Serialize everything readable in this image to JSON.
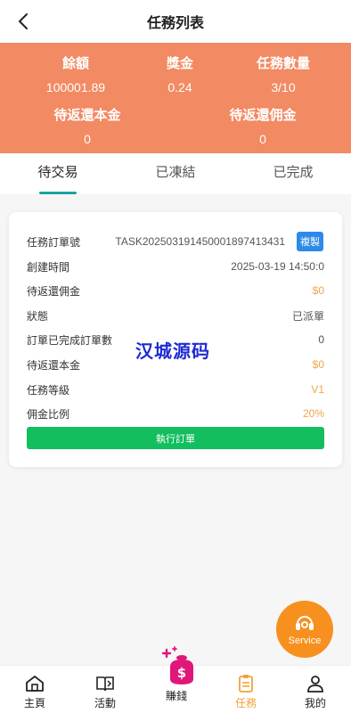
{
  "header": {
    "title": "任務列表"
  },
  "stats": {
    "balance_label": "餘額",
    "balance_value": "100001.89",
    "bonus_label": "獎金",
    "bonus_value": "0.24",
    "task_count_label": "任務數量",
    "task_count_value": "3/10",
    "pending_principal_label": "待返還本金",
    "pending_principal_value": "0",
    "pending_commission_label": "待返還佣金",
    "pending_commission_value": "0"
  },
  "tabs": [
    {
      "label": "待交易",
      "active": true
    },
    {
      "label": "已凍結",
      "active": false
    },
    {
      "label": "已完成",
      "active": false
    }
  ],
  "task": {
    "order_no_label": "任務訂單號",
    "order_no_value": "TASK2025031914500018974134​31",
    "copy_label": "複製",
    "created_label": "創建時間",
    "created_value": "2025-03-19 14:50:0",
    "pending_commission_label": "待返還佣金",
    "pending_commission_value": "$0",
    "status_label": "狀態",
    "status_value": "已派單",
    "completed_orders_label": "訂單已完成訂單數",
    "completed_orders_value": "0",
    "pending_principal_label": "待返還本金",
    "pending_principal_value": "$0",
    "level_label": "任務等級",
    "level_value": "V1",
    "commission_rate_label": "佣金比例",
    "commission_rate_value": "20%",
    "execute_label": "執行訂單"
  },
  "watermark": "汉城源码",
  "service_label": "Service",
  "nav": {
    "home": "主頁",
    "activity": "活動",
    "earn": "賺錢",
    "task": "任務",
    "mine": "我的"
  },
  "colors": {
    "accent": "#f28a63",
    "teal": "#1aa5a0",
    "green": "#12be5e",
    "blue": "#2d8ae8",
    "orange": "#f7901e"
  }
}
